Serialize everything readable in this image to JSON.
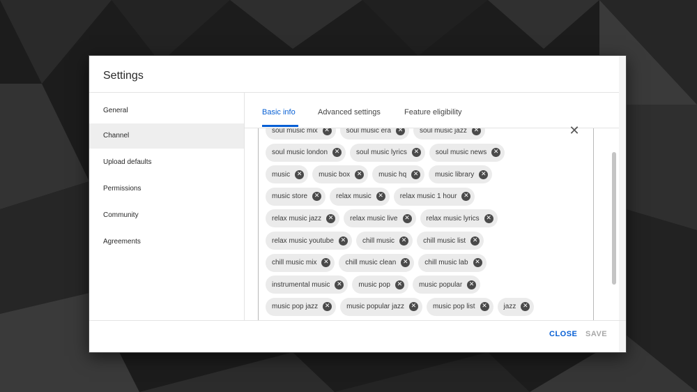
{
  "dialog": {
    "title": "Settings",
    "close_label": "CLOSE",
    "save_label": "SAVE"
  },
  "sidebar": {
    "items": [
      {
        "label": "General"
      },
      {
        "label": "Channel"
      },
      {
        "label": "Upload defaults"
      },
      {
        "label": "Permissions"
      },
      {
        "label": "Community"
      },
      {
        "label": "Agreements"
      }
    ],
    "active_index": 1
  },
  "tabs": [
    {
      "label": "Basic info"
    },
    {
      "label": "Advanced settings"
    },
    {
      "label": "Feature eligibility"
    }
  ],
  "tags": {
    "rows": [
      [
        "soul music mix",
        "soul music era",
        "soul music jazz"
      ],
      [
        "soul music london",
        "soul music lyrics",
        "soul music news"
      ],
      [
        "music",
        "music box",
        "music hq",
        "music library"
      ],
      [
        "music store",
        "relax music",
        "relax music 1 hour"
      ],
      [
        "relax music jazz",
        "relax music live",
        "relax music lyrics"
      ],
      [
        "relax music youtube",
        "chill music",
        "chill music list"
      ],
      [
        "chill music mix",
        "chill music clean",
        "chill music lab"
      ],
      [
        "instrumental music",
        "music pop",
        "music popular"
      ],
      [
        "music pop jazz",
        "music popular jazz",
        "music pop list",
        "jazz"
      ]
    ],
    "remove_icon": "close-circle-icon",
    "clear_icon": "close-icon"
  },
  "colors": {
    "accent": "#065fd4",
    "chip_bg": "#ebebeb",
    "disabled": "#a8a8a8"
  }
}
